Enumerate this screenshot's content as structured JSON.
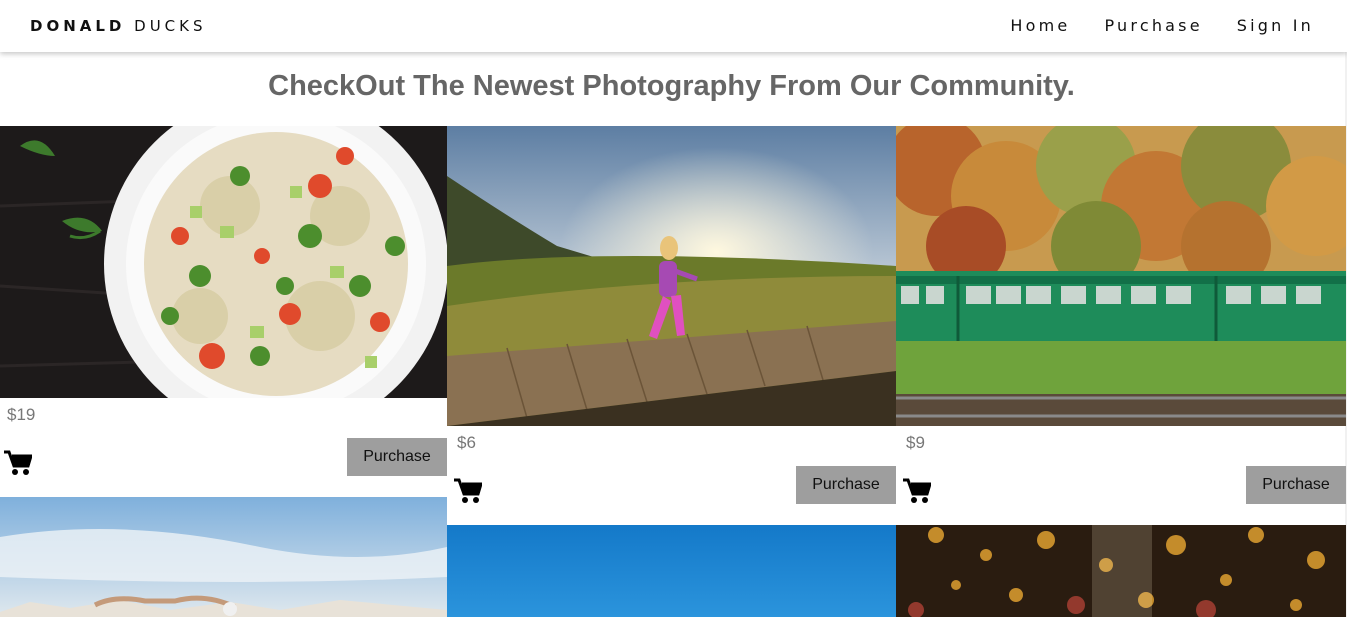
{
  "navbar": {
    "brand_bold": "DONALD",
    "brand_rest": "DUCKS",
    "links": [
      "Home",
      "Purchase",
      "Sign In"
    ]
  },
  "headline": "CheckOut The Newest Photography From Our Community.",
  "cards": [
    {
      "image": "tabbouleh-salad-photo",
      "price": "$19",
      "button": "Purchase",
      "icon": "shopping-cart-icon"
    },
    {
      "image": "girl-running-boardwalk-photo",
      "price": "$6",
      "button": "Purchase",
      "icon": "shopping-cart-icon"
    },
    {
      "image": "green-train-autumn-photo",
      "price": "$9",
      "button": "Purchase",
      "icon": "shopping-cart-icon"
    },
    {
      "image": "beach-sky-photo"
    },
    {
      "image": "blue-sky-photo"
    },
    {
      "image": "bokeh-lights-photo"
    }
  ],
  "colors": {
    "button_bg": "#9e9e9e",
    "headline": "#666666",
    "price": "#777777"
  }
}
